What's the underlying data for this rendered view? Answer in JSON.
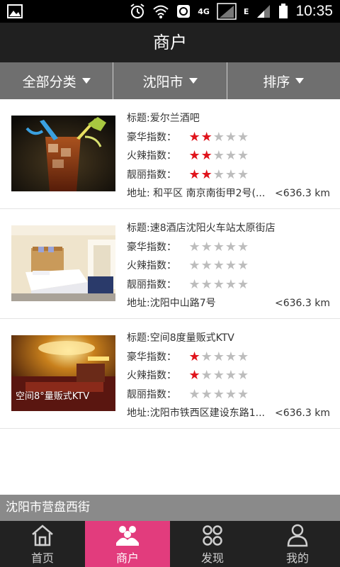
{
  "status_bar": {
    "network": "4G",
    "carrier_mark": "E",
    "time": "10:35"
  },
  "title": "商户",
  "filters": [
    {
      "label": "全部分类"
    },
    {
      "label": "沈阳市"
    },
    {
      "label": "排序"
    }
  ],
  "merchants": [
    {
      "title": "标题:爱尔兰酒吧",
      "ratings": [
        {
          "label": "豪华指数：",
          "value": 2,
          "max": 5
        },
        {
          "label": "火辣指数：",
          "value": 2,
          "max": 5
        },
        {
          "label": "靓丽指数：",
          "value": 2,
          "max": 5
        }
      ],
      "address": "地址: 和平区 南京南街甲2号(...",
      "distance": "<636.3 km",
      "image": "bar-drink-photo"
    },
    {
      "title": "标题:速8酒店沈阳火车站太原街店",
      "ratings": [
        {
          "label": "豪华指数：",
          "value": 0,
          "max": 5
        },
        {
          "label": "火辣指数：",
          "value": 0,
          "max": 5
        },
        {
          "label": "靓丽指数：",
          "value": 0,
          "max": 5
        }
      ],
      "address": "地址:沈阳中山路7号",
      "distance": "<636.3 km",
      "image": "hotel-room-photo"
    },
    {
      "title": "标题:空间8度量贩式KTV",
      "ratings": [
        {
          "label": "豪华指数：",
          "value": 1,
          "max": 5
        },
        {
          "label": "火辣指数：",
          "value": 1,
          "max": 5
        },
        {
          "label": "靓丽指数：",
          "value": 0,
          "max": 5
        }
      ],
      "address": "地址:沈阳市铁西区建设东路1...",
      "distance": "<636.3 km",
      "image": "ktv-hall-photo",
      "image_text": "空间8°量贩式KTV"
    }
  ],
  "location": "沈阳市营盘西街",
  "nav": [
    {
      "label": "首页",
      "icon": "home-icon",
      "active": false
    },
    {
      "label": "商户",
      "icon": "merchants-icon",
      "active": true
    },
    {
      "label": "发现",
      "icon": "discover-icon",
      "active": false
    },
    {
      "label": "我的",
      "icon": "profile-icon",
      "active": false
    }
  ],
  "colors": {
    "accent": "#e23c7d",
    "star_on": "#e0141c",
    "star_off": "#bdbdbd",
    "title_bar": "#202020",
    "filter_bar": "#6f6f6f"
  }
}
